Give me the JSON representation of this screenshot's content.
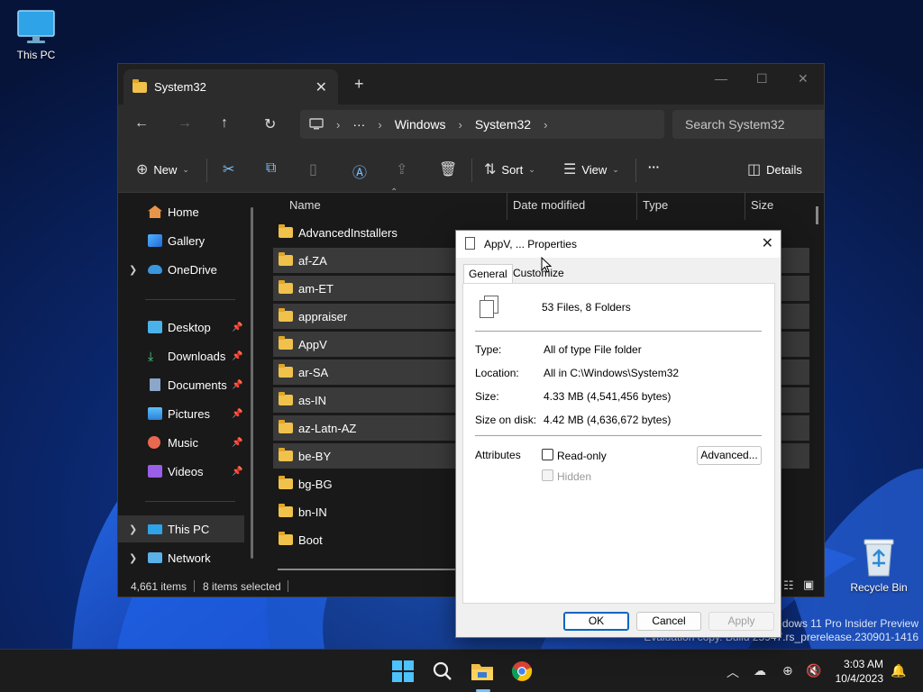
{
  "desktop": {
    "this_pc_label": "This PC",
    "recycle_bin_label": "Recycle Bin",
    "watermark_line1": "Windows 11 Pro Insider Preview",
    "watermark_line2": "Evaluation copy. Build 25947.rs_prerelease.230901-1416"
  },
  "explorer": {
    "tab_title": "System32",
    "address": {
      "overflow": "···",
      "crumbs": [
        "Windows",
        "System32"
      ]
    },
    "search_placeholder": "Search System32",
    "commands": {
      "new": "New",
      "sort": "Sort",
      "view": "View",
      "more": "···",
      "details": "Details"
    },
    "sidebar": [
      {
        "label": "Home",
        "icon": "home-icon"
      },
      {
        "label": "Gallery",
        "icon": "gallery-icon"
      },
      {
        "label": "OneDrive",
        "icon": "cloud-icon"
      },
      {
        "label": "Desktop",
        "icon": "desktop-icon"
      },
      {
        "label": "Downloads",
        "icon": "download-icon"
      },
      {
        "label": "Documents",
        "icon": "documents-icon"
      },
      {
        "label": "Pictures",
        "icon": "pictures-icon"
      },
      {
        "label": "Music",
        "icon": "music-icon"
      },
      {
        "label": "Videos",
        "icon": "videos-icon"
      },
      {
        "label": "This PC",
        "icon": "computer-icon"
      },
      {
        "label": "Network",
        "icon": "network-icon"
      }
    ],
    "columns": [
      "Name",
      "Date modified",
      "Type",
      "Size"
    ],
    "files": [
      "AdvancedInstallers",
      "af-ZA",
      "am-ET",
      "appraiser",
      "AppV",
      "ar-SA",
      "as-IN",
      "az-Latn-AZ",
      "be-BY",
      "bg-BG",
      "bn-IN",
      "Boot"
    ],
    "status": {
      "items": "4,661 items",
      "selected": "8 items selected"
    }
  },
  "properties": {
    "title": "AppV, ... Properties",
    "tabs": [
      "General",
      "Customize"
    ],
    "summary": "53 Files, 8 Folders",
    "type_label": "Type:",
    "type_value": "All of type File folder",
    "location_label": "Location:",
    "location_value": "All in C:\\Windows\\System32",
    "size_label": "Size:",
    "size_value": "4.33 MB (4,541,456 bytes)",
    "size_on_disk_label": "Size on disk:",
    "size_on_disk_value": "4.42 MB (4,636,672 bytes)",
    "attributes_label": "Attributes",
    "readonly_label": "Read-only",
    "hidden_label": "Hidden",
    "advanced_label": "Advanced...",
    "ok_label": "OK",
    "cancel_label": "Cancel",
    "apply_label": "Apply"
  },
  "taskbar": {
    "time": "3:03 AM",
    "date": "10/4/2023"
  }
}
